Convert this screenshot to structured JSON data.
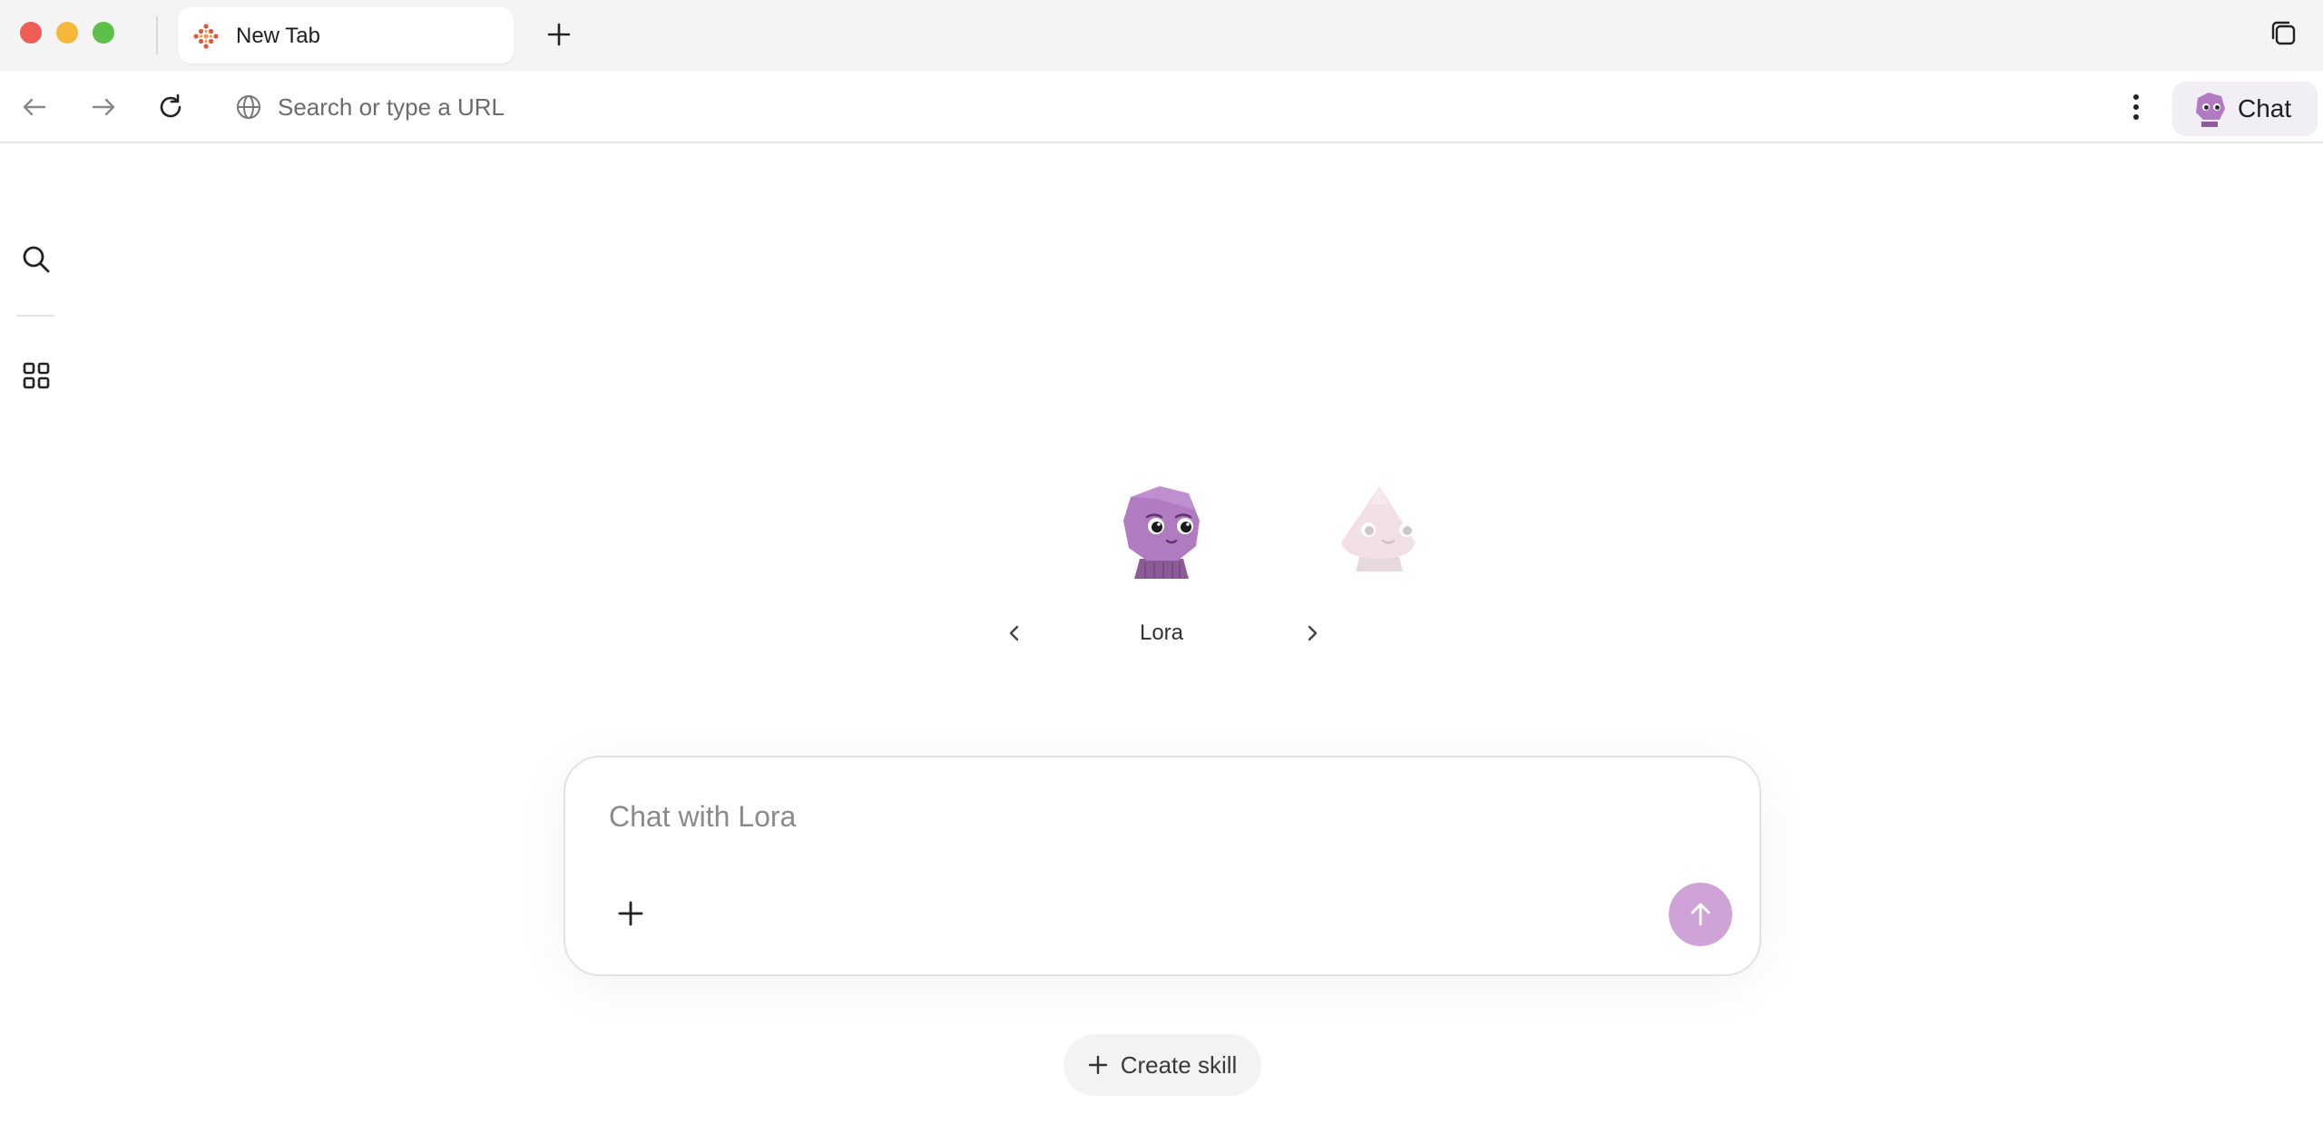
{
  "window": {
    "tab_title": "New Tab"
  },
  "toolbar": {
    "url_placeholder": "Search or type a URL",
    "chat_button_label": "Chat"
  },
  "assistant": {
    "current_character": "Lora"
  },
  "composer": {
    "placeholder": "Chat with Lora",
    "send_button_color": "#cfa3d8"
  },
  "actions": {
    "create_skill_label": "Create skill"
  },
  "icons": {
    "favicon": "diamond-dots-icon",
    "back": "arrow-left-icon",
    "forward": "arrow-right-icon",
    "reload": "reload-icon",
    "globe": "globe-icon",
    "more": "more-vertical-icon",
    "search": "search-icon",
    "apps": "grid-icon",
    "send": "arrow-up-icon",
    "attach": "plus-icon"
  }
}
